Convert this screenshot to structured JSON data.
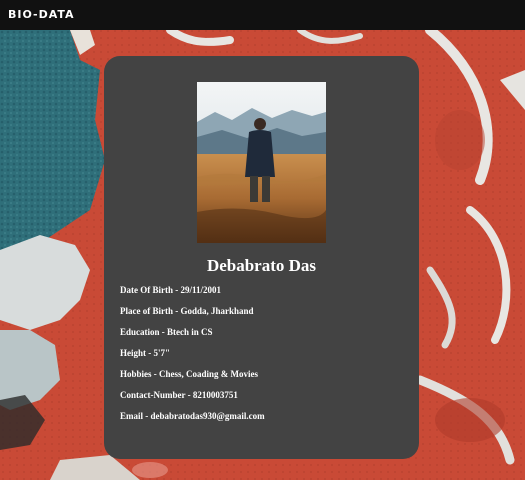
{
  "header": {
    "brand": "BIO-DATA"
  },
  "profile": {
    "name": "Debabrato Das",
    "details": [
      "Date Of Birth - 29/11/2001",
      "Place of Birth - Godda, Jharkhand",
      "Education - Btech in CS",
      "Height - 5'7\"",
      "Hobbies - Chess, Coading & Movies",
      "Contact-Number - 8210003751",
      "Email - debabratodas930@gmail.com"
    ]
  },
  "colors": {
    "topbar": "#111111",
    "card": "#434343",
    "text": "#ffffff",
    "background_red": "#c94a36",
    "background_teal": "#2f6f7a"
  },
  "icons": {
    "profile_photo": "person-in-field-photo"
  }
}
